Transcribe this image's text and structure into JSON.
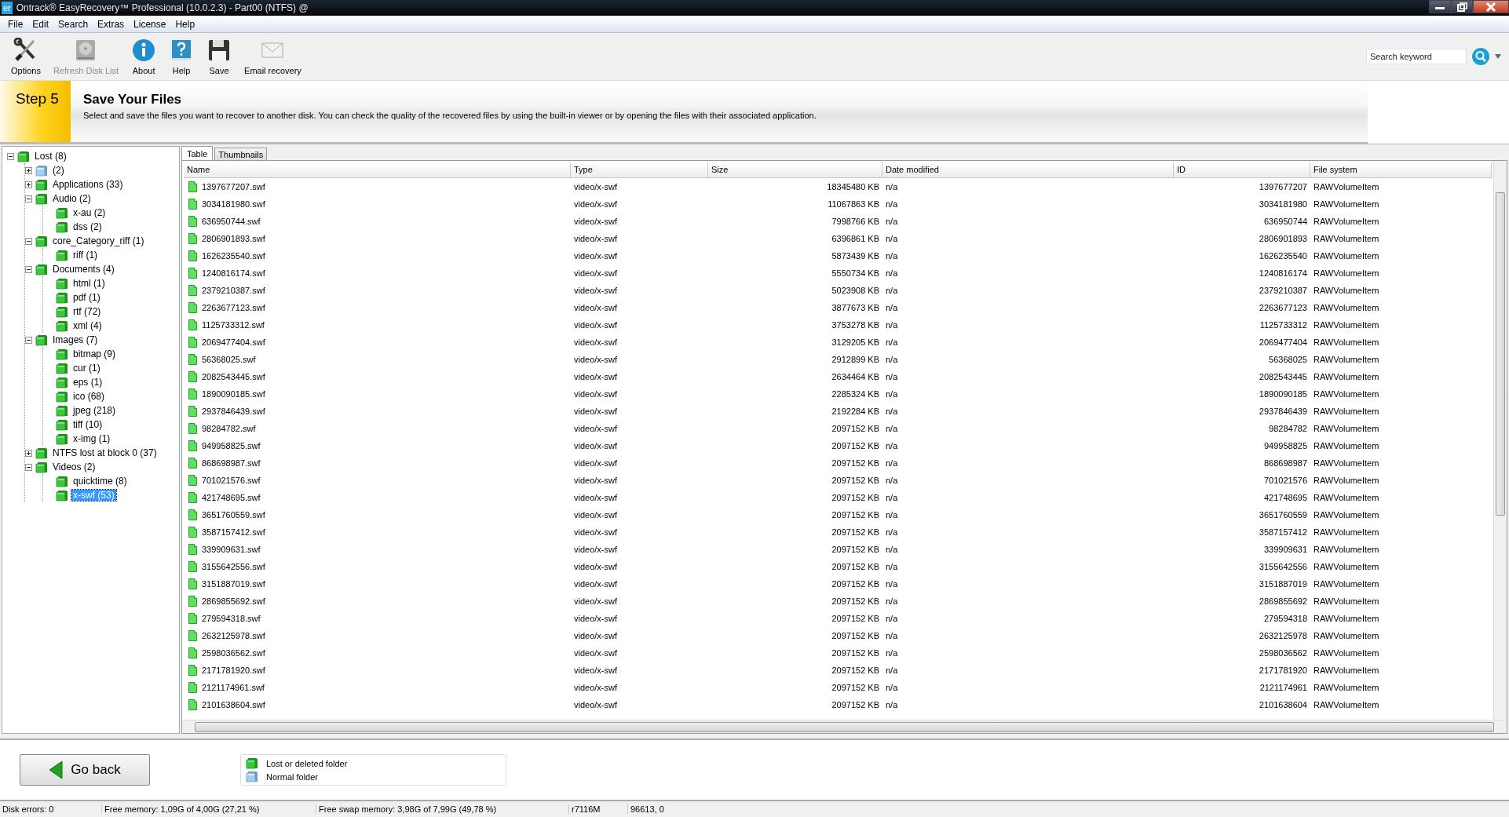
{
  "window": {
    "title": "Ontrack® EasyRecovery™ Professional (10.0.2.3) - Part00 (NTFS) @",
    "app_badge": "er"
  },
  "menu": [
    "File",
    "Edit",
    "Search",
    "Extras",
    "License",
    "Help"
  ],
  "toolbar": [
    {
      "kind": "options",
      "label": "Options",
      "disabled": false
    },
    {
      "kind": "disk",
      "label": "Refresh Disk List",
      "disabled": true
    },
    {
      "kind": "about",
      "label": "About",
      "disabled": false
    },
    {
      "kind": "help",
      "label": "Help",
      "disabled": false
    },
    {
      "kind": "save",
      "label": "Save",
      "disabled": false
    },
    {
      "kind": "email",
      "label": "Email recovery",
      "disabled": false
    }
  ],
  "search": {
    "placeholder": "Search keyword"
  },
  "step": {
    "badge": "Step 5",
    "title": "Save Your Files",
    "description": "Select and save the files you want to recover to another disk. You can check the quality of the recovered files by using the built-in viewer or by opening the files with their associated application."
  },
  "tree": [
    {
      "label": "Lost (8)",
      "kind": "lost",
      "expanded": true,
      "selected": false,
      "children": [
        {
          "label": "(2)",
          "kind": "normal",
          "expanded": false,
          "selected": false
        },
        {
          "label": "Applications (33)",
          "kind": "lost",
          "expanded": false,
          "selected": false
        },
        {
          "label": "Audio (2)",
          "kind": "lost",
          "expanded": true,
          "selected": false,
          "children": [
            {
              "label": "x-au (2)",
              "kind": "lost",
              "selected": false
            },
            {
              "label": "dss (2)",
              "kind": "lost",
              "selected": false
            }
          ]
        },
        {
          "label": "core_Category_riff (1)",
          "kind": "lost",
          "expanded": true,
          "selected": false,
          "children": [
            {
              "label": "riff (1)",
              "kind": "lost",
              "selected": false
            }
          ]
        },
        {
          "label": "Documents (4)",
          "kind": "lost",
          "expanded": true,
          "selected": false,
          "children": [
            {
              "label": "html (1)",
              "kind": "lost",
              "selected": false
            },
            {
              "label": "pdf (1)",
              "kind": "lost",
              "selected": false
            },
            {
              "label": "rtf (72)",
              "kind": "lost",
              "selected": false
            },
            {
              "label": "xml (4)",
              "kind": "lost",
              "selected": false
            }
          ]
        },
        {
          "label": "Images (7)",
          "kind": "lost",
          "expanded": true,
          "selected": false,
          "children": [
            {
              "label": "bitmap (9)",
              "kind": "lost",
              "selected": false
            },
            {
              "label": "cur (1)",
              "kind": "lost",
              "selected": false
            },
            {
              "label": "eps (1)",
              "kind": "lost",
              "selected": false
            },
            {
              "label": "ico (68)",
              "kind": "lost",
              "selected": false
            },
            {
              "label": "jpeg (218)",
              "kind": "lost",
              "selected": false
            },
            {
              "label": "tiff (10)",
              "kind": "lost",
              "selected": false
            },
            {
              "label": "x-img (1)",
              "kind": "lost",
              "selected": false
            }
          ]
        },
        {
          "label": "NTFS lost at block 0 (37)",
          "kind": "lost",
          "expanded": false,
          "selected": false
        },
        {
          "label": "Videos (2)",
          "kind": "lost",
          "expanded": true,
          "selected": false,
          "children": [
            {
              "label": "quicktime (8)",
              "kind": "lost",
              "selected": false
            },
            {
              "label": "x-swf (53)",
              "kind": "lost",
              "selected": true
            }
          ]
        }
      ]
    }
  ],
  "view_tabs": [
    {
      "label": "Table",
      "selected": true
    },
    {
      "label": "Thumbnails",
      "selected": false
    }
  ],
  "table": {
    "columns": [
      "Name",
      "Type",
      "Size",
      "Date modified",
      "ID",
      "File system"
    ],
    "rows": [
      [
        "1397677207.swf",
        "video/x-swf",
        "18345480 KB",
        "n/a",
        "1397677207",
        "RAWVolumeItem"
      ],
      [
        "3034181980.swf",
        "video/x-swf",
        "11067863 KB",
        "n/a",
        "3034181980",
        "RAWVolumeItem"
      ],
      [
        "636950744.swf",
        "video/x-swf",
        "7998766 KB",
        "n/a",
        "636950744",
        "RAWVolumeItem"
      ],
      [
        "2806901893.swf",
        "video/x-swf",
        "6396861 KB",
        "n/a",
        "2806901893",
        "RAWVolumeItem"
      ],
      [
        "1626235540.swf",
        "video/x-swf",
        "5873439 KB",
        "n/a",
        "1626235540",
        "RAWVolumeItem"
      ],
      [
        "1240816174.swf",
        "video/x-swf",
        "5550734 KB",
        "n/a",
        "1240816174",
        "RAWVolumeItem"
      ],
      [
        "2379210387.swf",
        "video/x-swf",
        "5023908 KB",
        "n/a",
        "2379210387",
        "RAWVolumeItem"
      ],
      [
        "2263677123.swf",
        "video/x-swf",
        "3877673 KB",
        "n/a",
        "2263677123",
        "RAWVolumeItem"
      ],
      [
        "1125733312.swf",
        "video/x-swf",
        "3753278 KB",
        "n/a",
        "1125733312",
        "RAWVolumeItem"
      ],
      [
        "2069477404.swf",
        "video/x-swf",
        "3129205 KB",
        "n/a",
        "2069477404",
        "RAWVolumeItem"
      ],
      [
        "56368025.swf",
        "video/x-swf",
        "2912899 KB",
        "n/a",
        "56368025",
        "RAWVolumeItem"
      ],
      [
        "2082543445.swf",
        "video/x-swf",
        "2634464 KB",
        "n/a",
        "2082543445",
        "RAWVolumeItem"
      ],
      [
        "1890090185.swf",
        "video/x-swf",
        "2285324 KB",
        "n/a",
        "1890090185",
        "RAWVolumeItem"
      ],
      [
        "2937846439.swf",
        "video/x-swf",
        "2192284 KB",
        "n/a",
        "2937846439",
        "RAWVolumeItem"
      ],
      [
        "98284782.swf",
        "video/x-swf",
        "2097152 KB",
        "n/a",
        "98284782",
        "RAWVolumeItem"
      ],
      [
        "949958825.swf",
        "video/x-swf",
        "2097152 KB",
        "n/a",
        "949958825",
        "RAWVolumeItem"
      ],
      [
        "868698987.swf",
        "video/x-swf",
        "2097152 KB",
        "n/a",
        "868698987",
        "RAWVolumeItem"
      ],
      [
        "701021576.swf",
        "video/x-swf",
        "2097152 KB",
        "n/a",
        "701021576",
        "RAWVolumeItem"
      ],
      [
        "421748695.swf",
        "video/x-swf",
        "2097152 KB",
        "n/a",
        "421748695",
        "RAWVolumeItem"
      ],
      [
        "3651760559.swf",
        "video/x-swf",
        "2097152 KB",
        "n/a",
        "3651760559",
        "RAWVolumeItem"
      ],
      [
        "3587157412.swf",
        "video/x-swf",
        "2097152 KB",
        "n/a",
        "3587157412",
        "RAWVolumeItem"
      ],
      [
        "339909631.swf",
        "video/x-swf",
        "2097152 KB",
        "n/a",
        "339909631",
        "RAWVolumeItem"
      ],
      [
        "3155642556.swf",
        "video/x-swf",
        "2097152 KB",
        "n/a",
        "3155642556",
        "RAWVolumeItem"
      ],
      [
        "3151887019.swf",
        "video/x-swf",
        "2097152 KB",
        "n/a",
        "3151887019",
        "RAWVolumeItem"
      ],
      [
        "2869855692.swf",
        "video/x-swf",
        "2097152 KB",
        "n/a",
        "2869855692",
        "RAWVolumeItem"
      ],
      [
        "279594318.swf",
        "video/x-swf",
        "2097152 KB",
        "n/a",
        "279594318",
        "RAWVolumeItem"
      ],
      [
        "2632125978.swf",
        "video/x-swf",
        "2097152 KB",
        "n/a",
        "2632125978",
        "RAWVolumeItem"
      ],
      [
        "2598036562.swf",
        "video/x-swf",
        "2097152 KB",
        "n/a",
        "2598036562",
        "RAWVolumeItem"
      ],
      [
        "2171781920.swf",
        "video/x-swf",
        "2097152 KB",
        "n/a",
        "2171781920",
        "RAWVolumeItem"
      ],
      [
        "2121174961.swf",
        "video/x-swf",
        "2097152 KB",
        "n/a",
        "2121174961",
        "RAWVolumeItem"
      ],
      [
        "2101638604.swf",
        "video/x-swf",
        "2097152 KB",
        "n/a",
        "2101638604",
        "RAWVolumeItem"
      ]
    ]
  },
  "go_back": {
    "label": "Go back"
  },
  "legend": [
    {
      "kind": "lost",
      "label": "Lost or deleted folder"
    },
    {
      "kind": "normal",
      "label": "Normal folder"
    }
  ],
  "status_bar": [
    "Disk errors: 0",
    "Free memory: 1,09G of 4,00G (27,21 %)",
    "Free swap memory: 3,98G of 7,99G (49,78 %)",
    "r7116M",
    "96613, 0"
  ]
}
